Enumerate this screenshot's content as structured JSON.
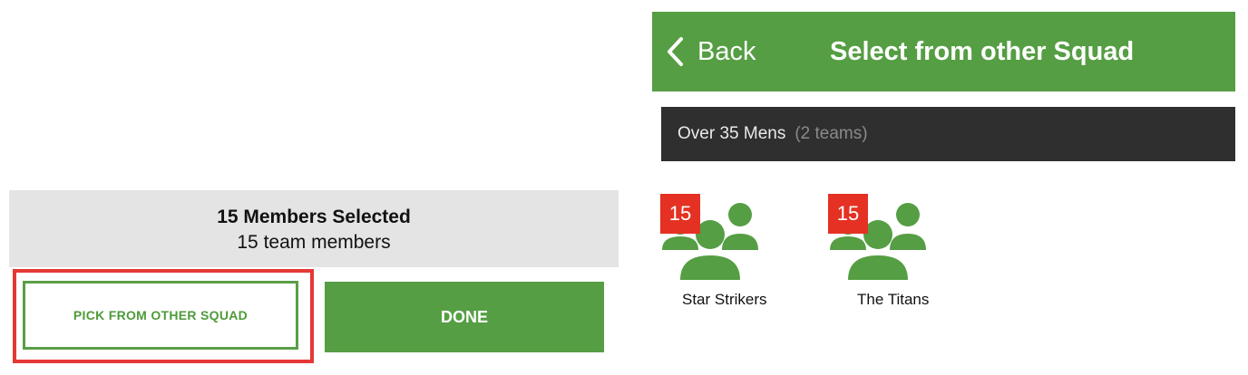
{
  "selection_summary": {
    "title": "15 Members Selected",
    "subtitle": "15 team members"
  },
  "actions": {
    "pick_label": "PICK FROM OTHER SQUAD",
    "done_label": "DONE"
  },
  "navbar": {
    "back_label": "Back",
    "title": "Select from other Squad"
  },
  "squad": {
    "name": "Over 35 Mens",
    "team_count": "(2 teams)"
  },
  "teams": [
    {
      "badge": "15",
      "name": "Star Strikers",
      "icon": "group-icon"
    },
    {
      "badge": "15",
      "name": "The Titans",
      "icon": "group-icon"
    }
  ],
  "colors": {
    "brand_green": "#559e43",
    "badge_red": "#e53123",
    "highlight_red": "#e53935",
    "section_dark": "#2f2f2f",
    "summary_gray": "#e4e4e4"
  }
}
